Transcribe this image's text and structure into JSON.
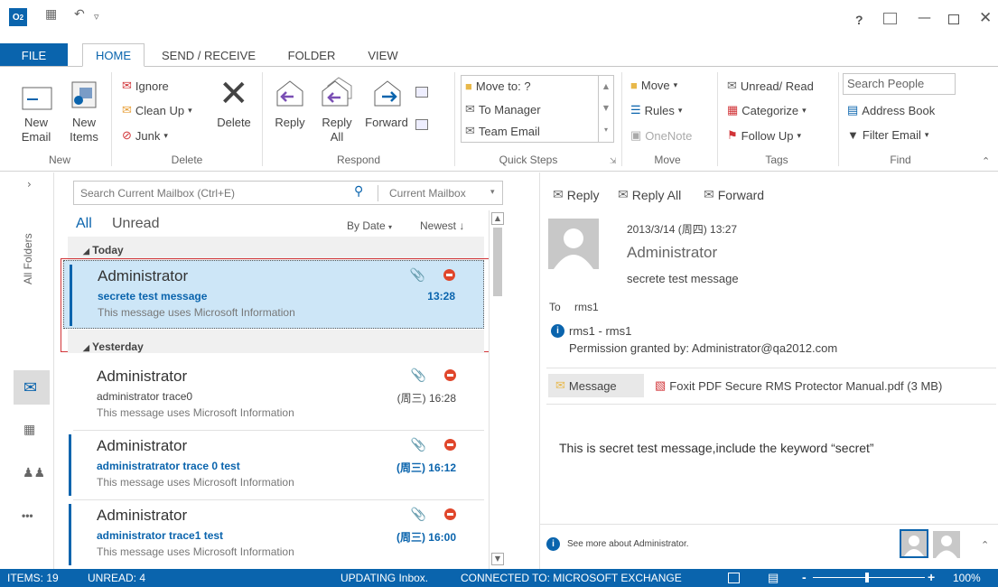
{
  "tabs": {
    "file": "FILE",
    "home": "HOME",
    "send_receive": "SEND / RECEIVE",
    "folder": "FOLDER",
    "view": "VIEW"
  },
  "window": {
    "help": "?"
  },
  "ribbon": {
    "new_email": "New\nEmail",
    "new_items": "New\nItems",
    "new_group": "New",
    "ignore": "Ignore",
    "clean_up": "Clean Up",
    "junk": "Junk",
    "delete": "Delete",
    "delete_group": "Delete",
    "reply": "Reply",
    "reply_all": "Reply\nAll",
    "forward": "Forward",
    "respond_group": "Respond",
    "quick_steps": [
      "Move to: ?",
      "To Manager",
      "Team Email"
    ],
    "quick_steps_group": "Quick Steps",
    "move": "Move",
    "rules": "Rules",
    "onenote": "OneNote",
    "move_group": "Move",
    "unread_read": "Unread/ Read",
    "categorize": "Categorize",
    "follow_up": "Follow Up",
    "tags_group": "Tags",
    "search_people": "Search People",
    "address_book": "Address Book",
    "filter_email": "Filter Email",
    "find_group": "Find"
  },
  "leftnav": {
    "all_folders": "All Folders",
    "more": "•••"
  },
  "search": {
    "placeholder": "Search Current Mailbox (Ctrl+E)",
    "scope": "Current Mailbox"
  },
  "filters": {
    "all": "All",
    "unread": "Unread",
    "by_date": "By Date",
    "newest": "Newest"
  },
  "groups": {
    "today": "Today",
    "yesterday": "Yesterday"
  },
  "messages": [
    {
      "from": "Administrator",
      "subject": "secrete test message",
      "preview": "This message uses Microsoft Information",
      "time": "13:28",
      "unread": true
    },
    {
      "from": "Administrator",
      "subject": "administrator trace0",
      "preview": "This message uses Microsoft Information",
      "time": "(周三) 16:28",
      "unread": false
    },
    {
      "from": "Administrator",
      "subject": "administratrator trace 0 test",
      "preview": "This message uses Microsoft Information",
      "time": "(周三) 16:12",
      "unread": true
    },
    {
      "from": "Administrator",
      "subject": "administrator trace1 test",
      "preview": "This message uses Microsoft Information",
      "time": "(周三) 16:00",
      "unread": true
    }
  ],
  "reading": {
    "reply": "Reply",
    "reply_all": "Reply All",
    "forward": "Forward",
    "date": "2013/3/14 (周四) 13:27",
    "sender": "Administrator",
    "subject": "secrete test message",
    "to_label": "To",
    "to_value": "rms1",
    "rms_line": "rms1 - rms1",
    "permission": "Permission granted by: Administrator@qa2012.com",
    "message_tab": "Message",
    "attachment": "Foxit PDF Secure RMS Protector Manual.pdf (3 MB)",
    "body": "This is secret test message,include the keyword “secret”",
    "see_more": "See more about Administrator."
  },
  "status": {
    "items": "ITEMS: 19",
    "unread": "UNREAD: 4",
    "updating": "UPDATING Inbox.",
    "connected": "CONNECTED TO: MICROSOFT EXCHANGE",
    "zoom": "100%"
  },
  "colors": {
    "accent": "#0a64ad",
    "selected": "#cde6f7",
    "highlight_border": "#d13438"
  }
}
